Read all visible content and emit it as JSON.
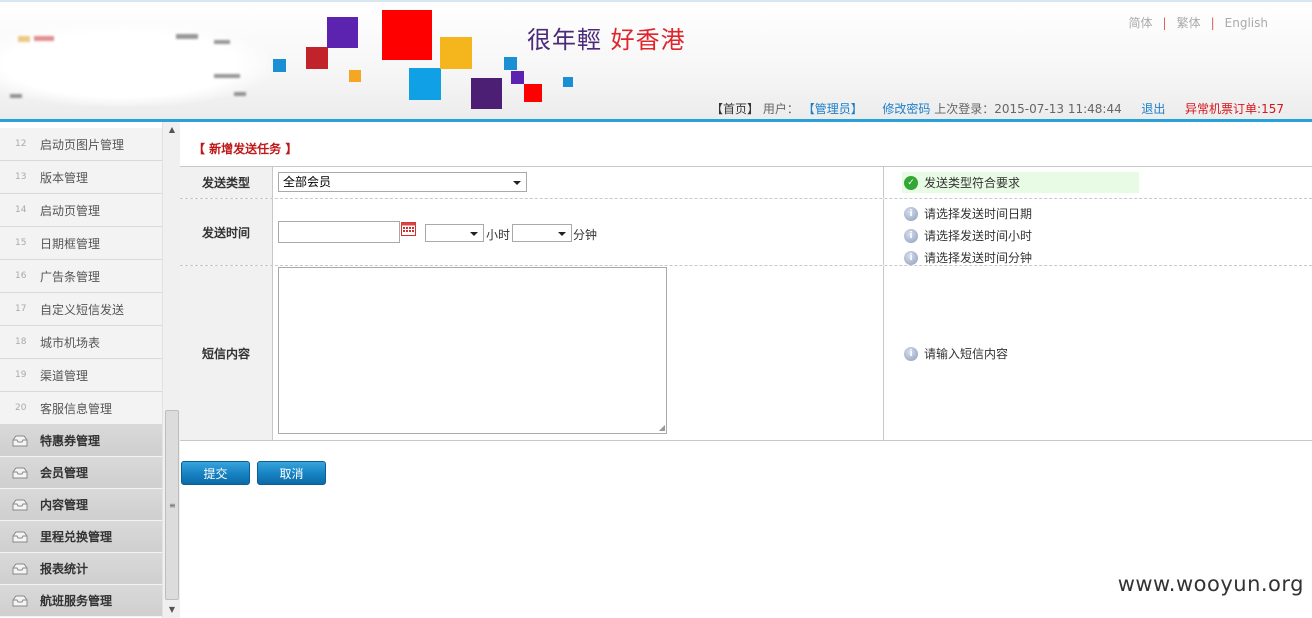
{
  "header": {
    "slogan_part1": "很年輕",
    "slogan_part2": "好香港",
    "languages": [
      "简体",
      "繁体",
      "English"
    ],
    "user_bar": {
      "home": "【首页】",
      "user_label": "用户：",
      "user_role": "【管理员】",
      "change_password": "修改密码",
      "last_login_label": "上次登录：",
      "last_login_time": "2015-07-13 11:48:44",
      "logout": "退出",
      "abnormal_orders": "异常机票订单:157"
    }
  },
  "sidebar": {
    "sub_items": [
      {
        "num": "12",
        "label": "启动页图片管理"
      },
      {
        "num": "13",
        "label": "版本管理"
      },
      {
        "num": "14",
        "label": "启动页管理"
      },
      {
        "num": "15",
        "label": "日期框管理"
      },
      {
        "num": "16",
        "label": "广告条管理"
      },
      {
        "num": "17",
        "label": "自定义短信发送"
      },
      {
        "num": "18",
        "label": "城市机场表"
      },
      {
        "num": "19",
        "label": "渠道管理"
      },
      {
        "num": "20",
        "label": "客服信息管理"
      }
    ],
    "main_items": [
      {
        "label": "特惠券管理"
      },
      {
        "label": "会员管理"
      },
      {
        "label": "内容管理"
      },
      {
        "label": "里程兑换管理"
      },
      {
        "label": "报表统计"
      },
      {
        "label": "航班服务管理"
      }
    ]
  },
  "content": {
    "title": "【 新增发送任务 】",
    "send_type": {
      "label": "发送类型",
      "selected": "全部会员",
      "hint": "发送类型符合要求"
    },
    "send_time": {
      "label": "发送时间",
      "date_value": "",
      "hour_selected": "",
      "hour_label": "小时",
      "minute_selected": "",
      "minute_label": "分钟",
      "hints": [
        "请选择发送时间日期",
        "请选择发送时间小时",
        "请选择发送时间分钟"
      ]
    },
    "sms_content": {
      "label": "短信内容",
      "value": "",
      "hint": "请输入短信内容"
    },
    "buttons": {
      "submit": "提交",
      "cancel": "取消"
    }
  },
  "watermark": "www.wooyun.org",
  "colors": {
    "accent_blue": "#2aa0d8",
    "title_red": "#c01818",
    "link_blue": "#1a7fc9",
    "alert_red": "#d8151c",
    "ok_green": "#33a635"
  }
}
